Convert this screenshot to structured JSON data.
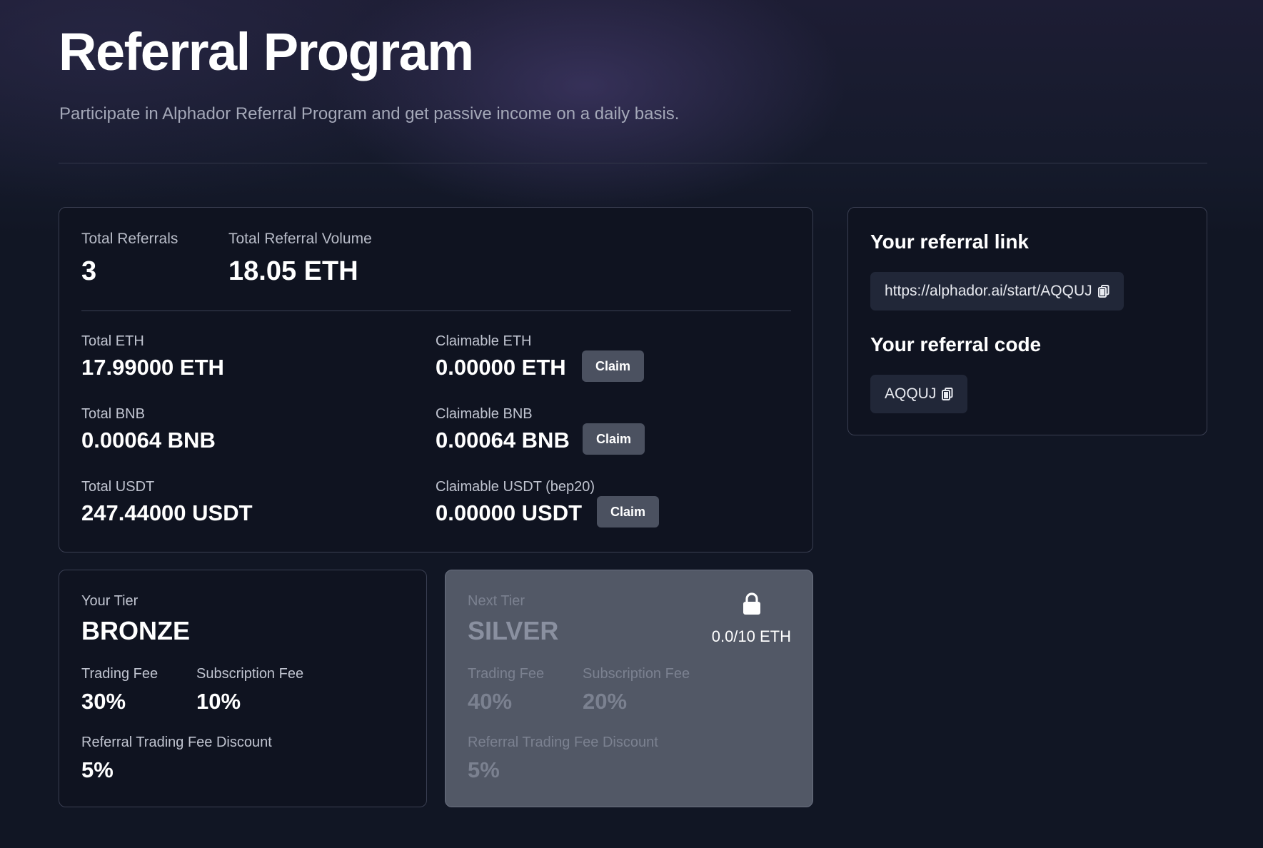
{
  "header": {
    "title": "Referral Program",
    "subtitle": "Participate in Alphador Referral Program and get passive income on a daily basis."
  },
  "stats": {
    "total_referrals_label": "Total Referrals",
    "total_referrals_value": "3",
    "total_volume_label": "Total Referral Volume",
    "total_volume_value": "18.05 ETH",
    "rows": [
      {
        "total_label": "Total ETH",
        "total_value": "17.99000 ETH",
        "claimable_label": "Claimable ETH",
        "claimable_value": "0.00000 ETH",
        "claim_label": "Claim"
      },
      {
        "total_label": "Total BNB",
        "total_value": "0.00064 BNB",
        "claimable_label": "Claimable BNB",
        "claimable_value": "0.00064 BNB",
        "claim_label": "Claim"
      },
      {
        "total_label": "Total USDT",
        "total_value": "247.44000 USDT",
        "claimable_label": "Claimable USDT (bep20)",
        "claimable_value": "0.00000 USDT",
        "claim_label": "Claim"
      }
    ]
  },
  "referral": {
    "link_heading": "Your referral link",
    "link_value": "https://alphador.ai/start/AQQUJ",
    "code_heading": "Your referral code",
    "code_value": "AQQUJ",
    "copy_icon": "copy-icon"
  },
  "current_tier": {
    "label": "Your Tier",
    "name": "BRONZE",
    "trading_fee_label": "Trading Fee",
    "trading_fee_value": "30%",
    "subscription_fee_label": "Subscription Fee",
    "subscription_fee_value": "10%",
    "discount_label": "Referral Trading Fee Discount",
    "discount_value": "5%"
  },
  "next_tier": {
    "label": "Next Tier",
    "name": "SILVER",
    "lock_icon": "lock-icon",
    "progress_text": "0.0/10 ETH",
    "progress_value": 0.0,
    "progress_target": 10,
    "trading_fee_label": "Trading Fee",
    "trading_fee_value": "40%",
    "subscription_fee_label": "Subscription Fee",
    "subscription_fee_value": "20%",
    "discount_label": "Referral Trading Fee Discount",
    "discount_value": "5%"
  },
  "colors": {
    "background": "#111624",
    "card": "#0f1320",
    "card_border": "#3a3f52",
    "next_tier_card": "#525866",
    "claim_button": "#4b5160",
    "copy_pill": "#212738"
  }
}
